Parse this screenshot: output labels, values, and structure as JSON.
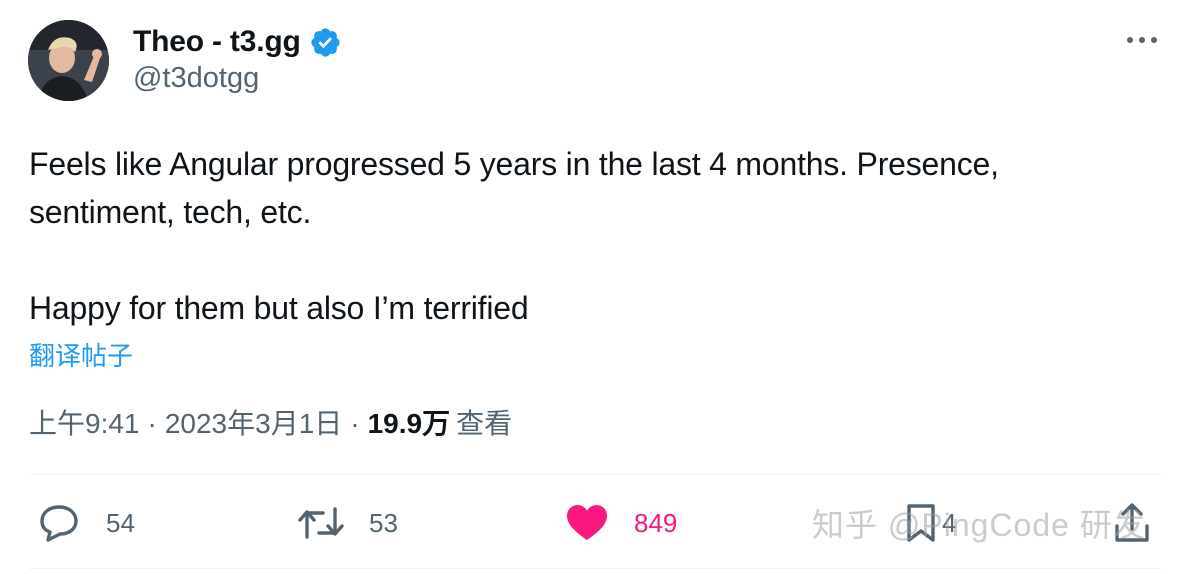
{
  "author": {
    "display_name": "Theo - t3.gg",
    "handle": "@t3dotgg",
    "verified": true
  },
  "tweet": {
    "lines": [
      "Feels like Angular progressed 5 years in the last 4 months. Presence,",
      "sentiment, tech, etc.",
      "Happy for them but also I’m terrified"
    ],
    "translate_label": "翻译帖子",
    "time": "上午9:41",
    "separator": "·",
    "date": "2023年3月1日",
    "views_count": "19.9万",
    "views_label": "查看"
  },
  "actions": {
    "reply": {
      "icon": "reply-icon",
      "count": "54"
    },
    "retweet": {
      "icon": "retweet-icon",
      "count": "53"
    },
    "like": {
      "icon": "heart-icon",
      "count": "849",
      "active": true
    },
    "bookmark": {
      "icon": "bookmark-icon",
      "count": "4"
    },
    "share": {
      "icon": "share-icon"
    }
  },
  "watermark": "知乎 @PingCode 研发",
  "colors": {
    "text": "#0f1419",
    "secondary": "#536471",
    "link": "#1d9bf0",
    "verified": "#1d9bf0",
    "like_active": "#f91880",
    "divider": "#eff3f4"
  }
}
